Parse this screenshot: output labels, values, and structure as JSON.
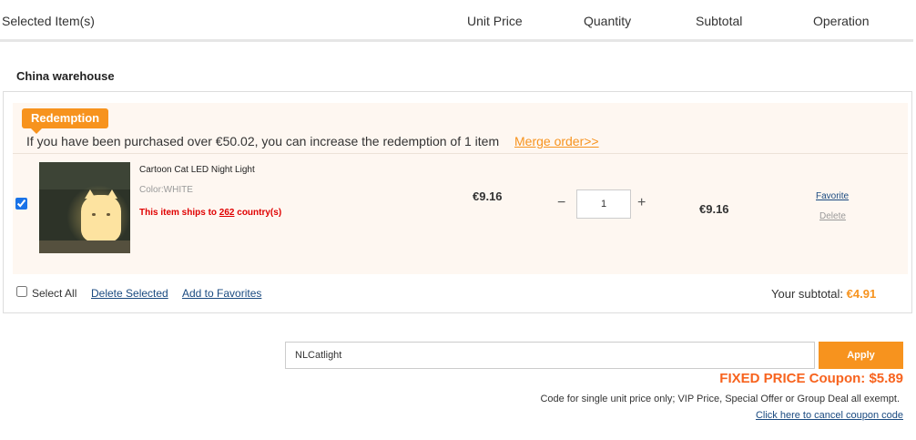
{
  "header": {
    "item": "Selected Item(s)",
    "unit_price": "Unit Price",
    "quantity": "Quantity",
    "subtotal": "Subtotal",
    "operation": "Operation"
  },
  "warehouse": "China warehouse",
  "promo": {
    "badge": "Redemption",
    "text": "If you have been purchased over €50.02, you can increase the redemption of 1 item",
    "merge_link": "Merge order>>"
  },
  "item": {
    "name": "Cartoon Cat LED Night Light",
    "color": "Color:WHITE",
    "ships_prefix": "This item ships to ",
    "ships_count": "262",
    "ships_suffix": " country(s)",
    "unit_price": "€9.16",
    "minus": "−",
    "quantity": "1",
    "plus": "+",
    "subtotal": "€9.16",
    "favorite": "Favorite",
    "delete": "Delete",
    "checked": true
  },
  "footer": {
    "select_all": "Select All",
    "delete_selected": "Delete Selected",
    "add_to_favorites": "Add to Favorites",
    "your_subtotal_label": "Your subtotal: ",
    "your_subtotal_value": "€4.91"
  },
  "coupon": {
    "value": "NLCatlight",
    "apply": "Apply",
    "fixed_price": "FIXED PRICE Coupon: $5.89",
    "note": "Code for single unit price only; VIP Price, Special Offer or Group Deal all exempt.",
    "cancel": "Click here to cancel coupon code"
  },
  "colors": {
    "accent": "#f7931e",
    "link": "#1a4a80",
    "alert": "#e00000",
    "promo_bg": "#fef7f1"
  }
}
